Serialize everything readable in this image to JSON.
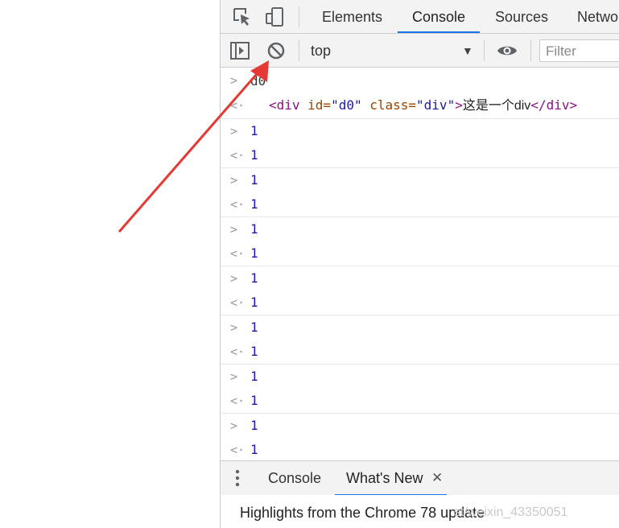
{
  "tabs": [
    "Elements",
    "Console",
    "Sources",
    "Netwo"
  ],
  "active_tab": "Console",
  "console_toolbar": {
    "context": "top",
    "filter_placeholder": "Filter"
  },
  "messages": {
    "first": {
      "input": "d0",
      "output": {
        "tag_open": "<div",
        "attr1": " id=",
        "val1": "\"d0\"",
        "attr2": " class=",
        "val2": "\"div\"",
        "gt": ">",
        "content": "这是一个div",
        "tag_close": "</div>"
      }
    },
    "pairs": [
      {
        "input": "1",
        "output": "1"
      },
      {
        "input": "1",
        "output": "1"
      },
      {
        "input": "1",
        "output": "1"
      },
      {
        "input": "1",
        "output": "1"
      },
      {
        "input": "1",
        "output": "1"
      },
      {
        "input": "1",
        "output": "1"
      },
      {
        "input": "1",
        "output": "1"
      }
    ],
    "input_glyph": ">",
    "output_glyph": "<·"
  },
  "drawer": {
    "tabs": [
      "Console",
      "What's New"
    ],
    "active": "What's New",
    "close_glyph": "✕",
    "highlight": "Highlights from the Chrome 78 update",
    "watermark": "st/weixin_43350051"
  },
  "icons": {
    "inspect": "inspect-element-icon",
    "device": "device-toolbar-icon",
    "sidebar": "show-sidebar-icon",
    "clear": "clear-console-icon",
    "eye": "live-expression-eye-icon",
    "kebab": "more-tools-kebab-icon"
  },
  "colors": {
    "accent": "#1a73e8",
    "arrow": "#e53935"
  }
}
